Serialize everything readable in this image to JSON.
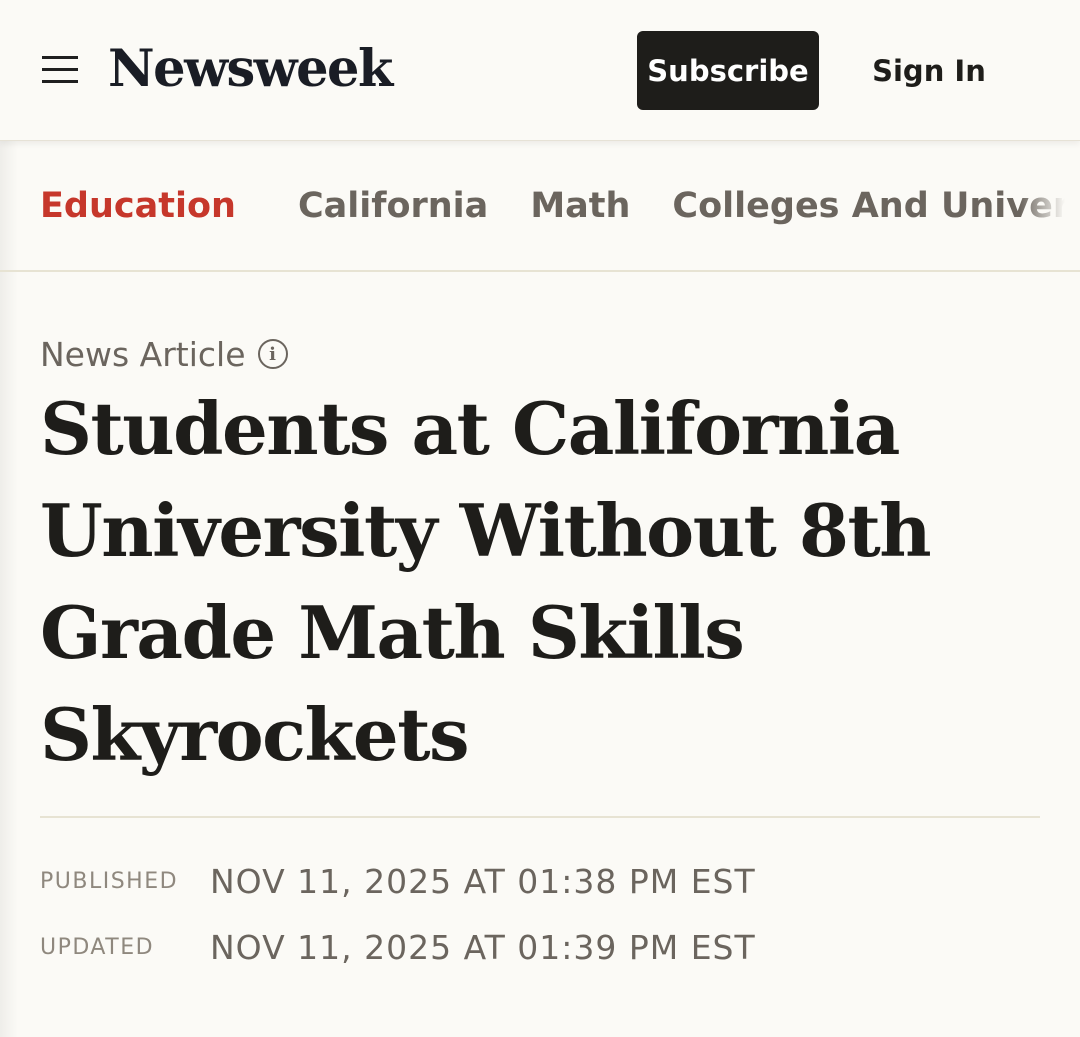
{
  "header": {
    "logo": "Newsweek",
    "subscribe_label": "Subscribe",
    "sign_in_label": "Sign In",
    "menu_icon": "hamburger-menu-icon"
  },
  "topics": {
    "items": [
      "Education",
      "California",
      "Math",
      "Colleges And Universities"
    ],
    "active": "Education",
    "colors": {
      "active": "#c6372b",
      "inactive": "#6b655e"
    }
  },
  "article": {
    "type_label": "News Article",
    "info_icon": "info-icon",
    "headline": "Students at California University Without 8th Grade Math Skills Skyrockets",
    "published_label": "PUBLISHED",
    "published_value": "NOV 11, 2025 AT 01:38 PM EST",
    "updated_label": "UPDATED",
    "updated_value": "NOV 11, 2025 AT 01:39 PM EST"
  },
  "colors": {
    "background": "#fbfaf6",
    "text_dark": "#1e1d1a",
    "subscribe_bg": "#1e1d1a"
  }
}
